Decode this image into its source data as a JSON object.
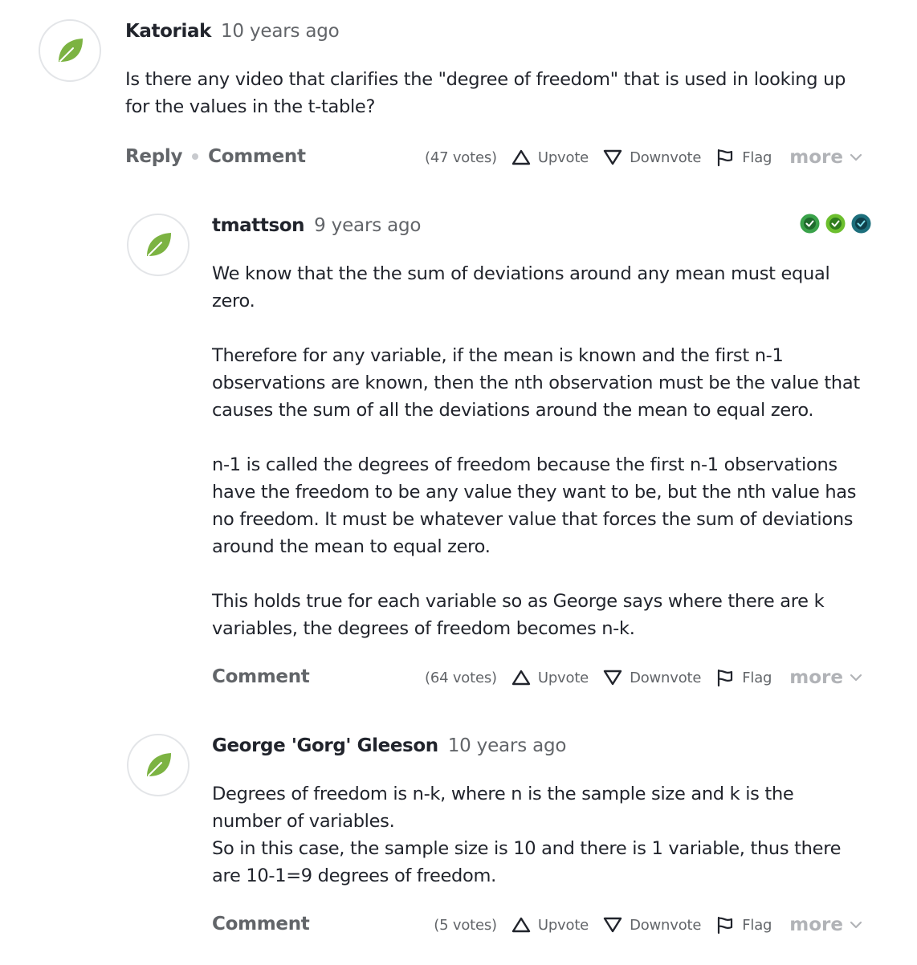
{
  "colors": {
    "leaf": "#7cb342",
    "badge_green": "#3aa24a",
    "badge_lime": "#6cbf2e",
    "badge_teal": "#1d6f7c"
  },
  "icons": {
    "avatar": "leaf-icon",
    "upvote": "triangle-up-icon",
    "downvote": "triangle-down-icon",
    "flag": "flag-icon",
    "more": "chevron-down-icon"
  },
  "posts": [
    {
      "author": "Katoriak",
      "time": "10 years ago",
      "paragraphs": [
        "Is there any video that clarifies the \"degree of freedom\" that is used in looking up\nfor the values in the t-table?"
      ],
      "reply_label": "Reply",
      "comment_label": "Comment",
      "votes": "(47 votes)",
      "upvote_label": "Upvote",
      "downvote_label": "Downvote",
      "flag_label": "Flag",
      "more_label": "more"
    },
    {
      "author": "tmattson",
      "time": "9 years ago",
      "badges": [
        "badge-green",
        "badge-lime",
        "badge-teal"
      ],
      "paragraphs": [
        "We know that the the sum of deviations around any mean must equal\nzero.",
        "Therefore for any variable, if the mean is known and the first n-1\nobservations are known, then the nth observation must be the value that\ncauses the sum of all the deviations around the mean to equal zero.",
        "n-1 is called the degrees of freedom because the first n-1 observations\nhave the freedom to be any value they want to be, but the nth value has\nno freedom. It must be whatever value that forces the sum of deviations\naround the mean to equal zero.",
        "This holds true for each variable so as George says where there are k\nvariables, the degrees of freedom becomes n-k."
      ],
      "comment_label": "Comment",
      "votes": "(64 votes)",
      "upvote_label": "Upvote",
      "downvote_label": "Downvote",
      "flag_label": "Flag",
      "more_label": "more"
    },
    {
      "author": "George 'Gorg' Gleeson",
      "time": "10 years ago",
      "paragraphs": [
        "Degrees of freedom is n-k, where n is the sample size and k is the\nnumber of variables.\nSo in this case, the sample size is 10 and there is 1 variable, thus there\nare 10-1=9 degrees of freedom."
      ],
      "comment_label": "Comment",
      "votes": "(5 votes)",
      "upvote_label": "Upvote",
      "downvote_label": "Downvote",
      "flag_label": "Flag",
      "more_label": "more"
    }
  ]
}
